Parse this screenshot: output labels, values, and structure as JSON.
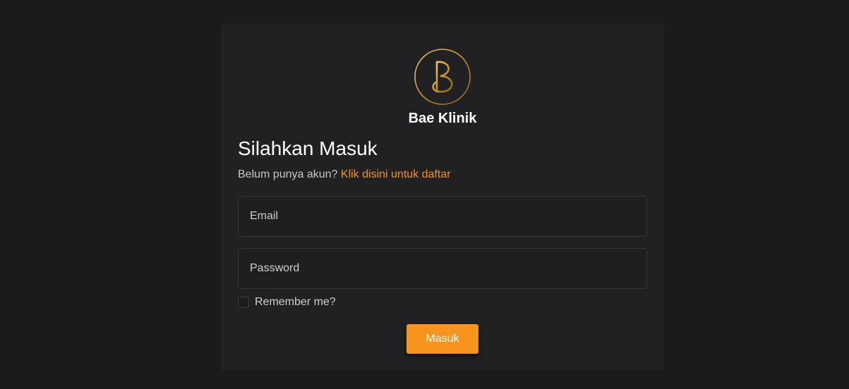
{
  "brand": {
    "name": "Bae Klinik",
    "logo_letter": "B",
    "logo_color": "#d4a843"
  },
  "login": {
    "title": "Silahkan Masuk",
    "register_prompt": "Belum punya akun?",
    "register_link": "Klik disini untuk daftar",
    "email_placeholder": "Email",
    "password_placeholder": "Password",
    "remember_label": "Remember me?",
    "submit_label": "Masuk"
  },
  "colors": {
    "background": "#1b1b1c",
    "card": "#212124",
    "accent": "#f7941d"
  }
}
